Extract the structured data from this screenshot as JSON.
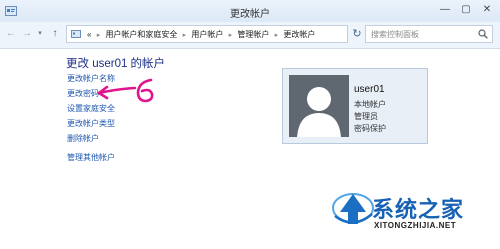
{
  "window": {
    "title": "更改帐户",
    "minimize": "—",
    "maximize": "▢",
    "close": "✕"
  },
  "nav": {
    "back": "←",
    "forward": "→",
    "up": "↑",
    "breadcrumb_prefix": "«",
    "breadcrumb": [
      "用户帐户和家庭安全",
      "用户帐户",
      "管理帐户",
      "更改帐户"
    ],
    "search_placeholder": "搜索控制面板"
  },
  "main": {
    "title": "更改 user01 的帐户",
    "links": [
      "更改帐户名称",
      "更改密码",
      "设置家庭安全",
      "更改帐户类型",
      "删除帐户",
      "管理其他帐户"
    ]
  },
  "account": {
    "name": "user01",
    "type": "本地帐户",
    "role": "管理员",
    "protection": "密码保护"
  },
  "annotation": {
    "color": "#e0148c",
    "figure": "6"
  },
  "watermark": {
    "text": "系统之家",
    "url": "XITONGZHIJIA.NET",
    "color": "#1762b4"
  },
  "colors": {
    "link": "#1e57b0",
    "heading": "#1e3287",
    "avatar_bg": "#5f6771",
    "card_bg": "#e9eff7"
  }
}
